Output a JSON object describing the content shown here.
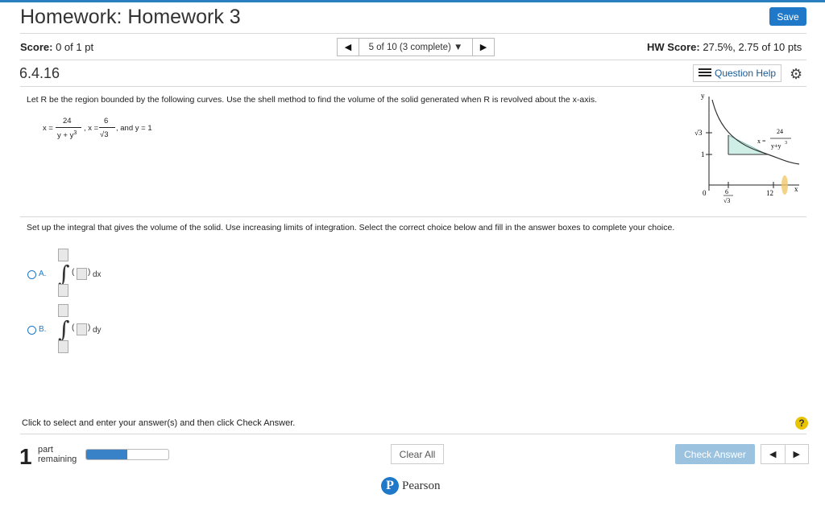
{
  "header": {
    "title": "Homework: Homework 3",
    "save_label": "Save"
  },
  "score": {
    "label": "Score:",
    "value": "0 of 1 pt"
  },
  "question_nav": {
    "prev_icon": "left-triangle-icon",
    "position_text": "5 of 10 (3 complete) ▼",
    "next_icon": "right-triangle-icon"
  },
  "hw_score": {
    "label": "HW Score:",
    "value": "27.5%, 2.75 of 10 pts"
  },
  "question": {
    "number": "6.4.16",
    "help_label": "Question Help",
    "prompt": "Let R be the region bounded by the following curves. Use the shell method to find the volume of the solid generated when R is revolved about the x-axis.",
    "eq1_lhs": "x =",
    "eq1_num": "24",
    "eq1_den": "y + y",
    "eq1_den_exp": "3",
    "eq2_lhs": ", x =",
    "eq2_num": "6",
    "eq2_den": "√3",
    "eq3": ", and y = 1",
    "setup_text": "Set up the integral that gives the volume of the solid. Use increasing limits of integration. Select the correct choice below and fill in the answer boxes to complete your choice."
  },
  "graph": {
    "y_axis_label": "y",
    "x_axis_label": "x",
    "y_tick_sqrt3": "√3",
    "y_tick_1": "1",
    "x_tick_0": "0",
    "x_tick_frac_num": "6",
    "x_tick_frac_den": "√3",
    "x_tick_12": "12",
    "curve_label_lhs": "x =",
    "curve_label_num": "24",
    "curve_label_den": "y+y",
    "curve_label_exp": "3",
    "shaded_color": "#cfeee6"
  },
  "options": [
    {
      "label": "A.",
      "differential": "dx"
    },
    {
      "label": "B.",
      "differential": "dy"
    }
  ],
  "footer": {
    "instruction": "Click to select and enter your answer(s) and then click Check Answer.",
    "help_icon_text": "?",
    "parts_count": "1",
    "parts_label_1": "part",
    "parts_label_2": "remaining",
    "progress_fraction": 0.5,
    "clear_label": "Clear All",
    "check_label": "Check Answer",
    "brand": "Pearson",
    "brand_initial": "P"
  },
  "colors": {
    "accent": "#1f78c8",
    "check_disabled": "#9bc3e0",
    "help_yellow": "#e8c300"
  }
}
